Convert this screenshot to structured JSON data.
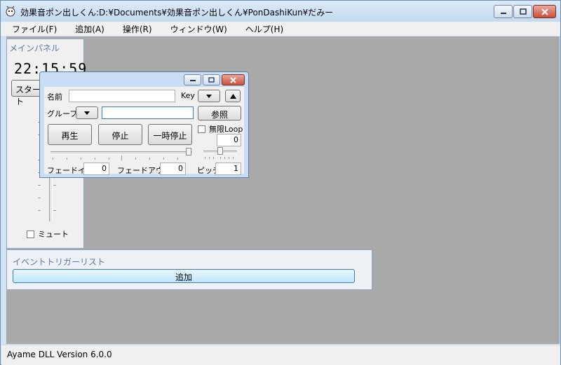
{
  "window": {
    "title": "効果音ポン出しくん:D:¥Documents¥効果音ポン出しくん¥PonDashiKun¥だみー"
  },
  "menu": {
    "items": [
      {
        "label": "ファイル(F)"
      },
      {
        "label": "追加(A)"
      },
      {
        "label": "操作(R)"
      },
      {
        "label": "ウィンドウ(W)"
      },
      {
        "label": "ヘルプ(H)"
      }
    ]
  },
  "main_panel": {
    "caption": "メインパネル",
    "clock": "22:15:59",
    "start_label": "スタート",
    "mute_label": "ミュート",
    "mute_checked": false
  },
  "event_panel": {
    "caption": "イベントトリガーリスト",
    "add_label": "追加"
  },
  "dialog": {
    "name_label": "名前",
    "name_value": "",
    "key_label": "Key",
    "group_label": "グループ",
    "group_value": "",
    "browse_label": "参照",
    "play_label": "再生",
    "stop_label": "停止",
    "pause_label": "一時停止",
    "loop_label": "無限Loop",
    "loop_checked": false,
    "loop_count": "0",
    "fade_in_label": "フェードイン",
    "fade_in_value": "0",
    "fade_out_label": "フェードアウト",
    "fade_out_value": "0",
    "pitch_label": "ピッチ",
    "pitch_value": "1"
  },
  "status": {
    "text": "Ayame DLL Version 6.0.0"
  },
  "colors": {
    "client_bg": "#a9a9a9",
    "titlebar": "#c3daf0",
    "close_button": "#c9503c"
  }
}
